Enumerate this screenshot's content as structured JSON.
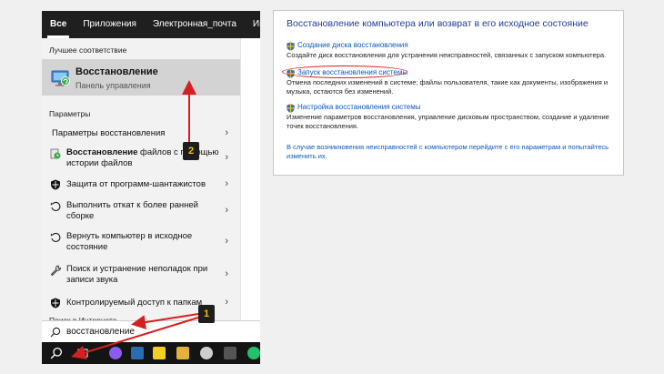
{
  "tabs": [
    {
      "label": "Все",
      "active": true
    },
    {
      "label": "Приложения",
      "active": false
    },
    {
      "label": "Электронная_почта",
      "active": false
    },
    {
      "label": "Интернет",
      "active": false
    }
  ],
  "best_match": {
    "section_title": "Лучшее соответствие",
    "title": "Восстановление",
    "subtitle": "Панель управления",
    "icon": "recovery-monitor-icon"
  },
  "settings": {
    "section_title": "Параметры",
    "items": [
      {
        "bold": "",
        "text": "Параметры восстановления",
        "icon": "none"
      },
      {
        "bold": "Восстановление",
        "text": " файлов с помощью истории файлов",
        "icon": "file-history-icon"
      },
      {
        "bold": "",
        "text": "Защита от программ-шантажистов",
        "icon": "shield-icon"
      },
      {
        "bold": "",
        "text": "Выполнить откат к более ранней сборке",
        "icon": "restore-icon"
      },
      {
        "bold": "",
        "text": "Вернуть компьютер в исходное состояние",
        "icon": "restore-icon"
      },
      {
        "bold": "",
        "text": "Поиск и устранение неполадок при записи звука",
        "icon": "wrench-icon"
      },
      {
        "bold": "",
        "text": "Контролируемый доступ к папкам",
        "icon": "shield-icon"
      }
    ]
  },
  "web": {
    "section_title": "Поиск в Интернете"
  },
  "search": {
    "value": "восстановление"
  },
  "panel": {
    "title": "Восстановление компьютера или возврат в его исходное состояние",
    "entries": [
      {
        "link": "Создание диска восстановления",
        "desc": "Создайте диск восстановления для устранения неисправностей, связанных с запуском компьютера."
      },
      {
        "link": "Запуск восстановления системы",
        "desc": "Отмена последних изменений в системе; файлы пользователя, такие как документы, изображения и музыка, остаются без изменений."
      },
      {
        "link": "Настройка восстановления системы",
        "desc": "Изменение параметров восстановления, управление дисковым пространством, создание и удаление точек восстановления."
      }
    ],
    "footer": "В случае возникновения неисправностей с компьютером перейдите с его параметрам и попытайтесь изменить их."
  },
  "badges": {
    "one": "1",
    "two": "2"
  },
  "colors": {
    "accent_red": "#d62020",
    "link_blue": "#0a58c0",
    "title_blue": "#1e3c96",
    "badge_yellow": "#f2c400"
  }
}
